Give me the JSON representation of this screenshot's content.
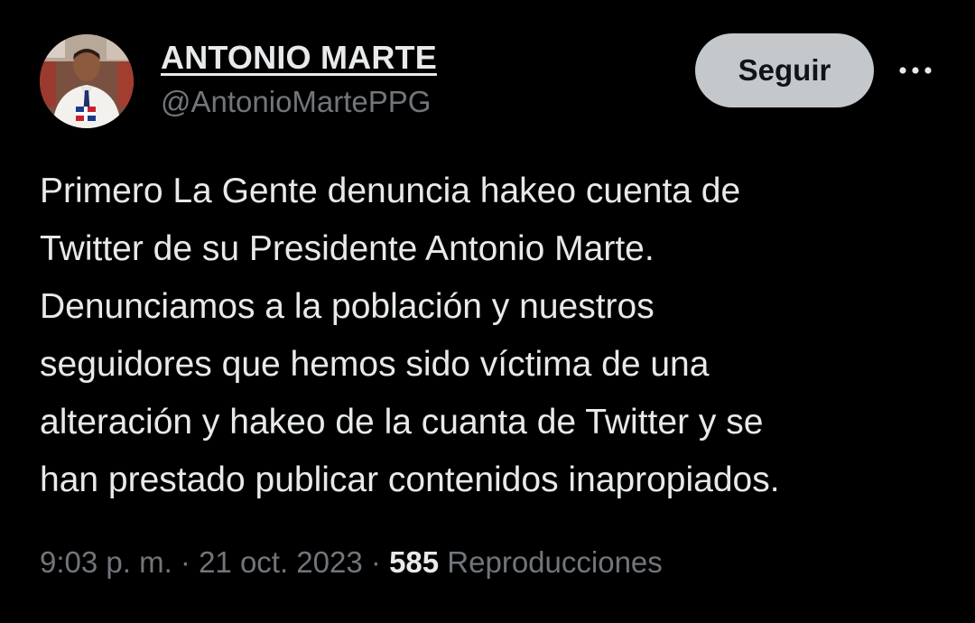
{
  "author": {
    "display_name": "ANTONIO MARTE",
    "handle": "@AntonioMartePPG",
    "avatar_icon": "profile-photo"
  },
  "actions": {
    "follow_label": "Seguir",
    "more_icon": "more-horizontal-icon"
  },
  "tweet": {
    "text": "Primero La Gente denuncia hakeo cuenta de\nTwitter de su Presidente Antonio Marte.\nDenunciamos a la población y nuestros\nseguidores que hemos sido víctima de una\nalteración y hakeo de la cuanta de Twitter y se\nhan prestado publicar contenidos inapropiados."
  },
  "meta": {
    "time": "9:03 p. m.",
    "separator": " · ",
    "date": "21 oct. 2023",
    "views_count": "585",
    "views_label": "Reproducciones"
  },
  "colors": {
    "background": "#000000",
    "primary_text": "#e7e9ea",
    "secondary_text": "#71767b",
    "follow_button_bg": "#c5c8cb",
    "follow_button_text": "#0f1419"
  }
}
